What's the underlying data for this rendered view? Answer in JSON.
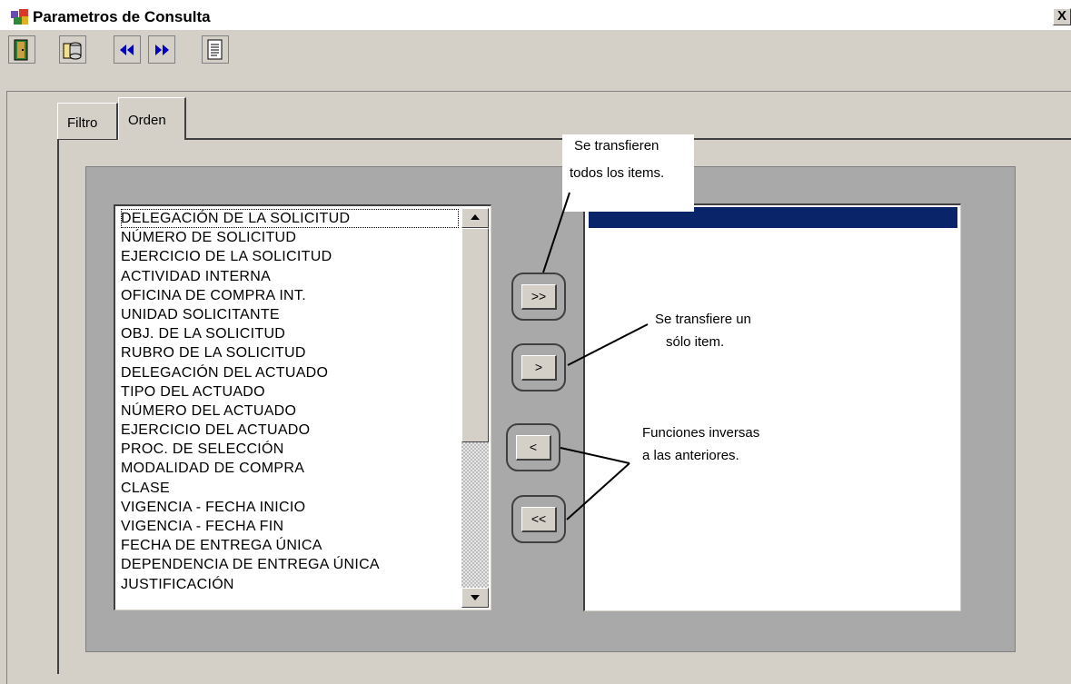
{
  "window": {
    "title": "Parametros de Consulta",
    "close_label": "X"
  },
  "toolbar": {
    "buttons": [
      {
        "icon": "exit-door-icon"
      },
      {
        "icon": "database-query-icon"
      },
      {
        "icon": "previous-icon"
      },
      {
        "icon": "next-icon"
      },
      {
        "icon": "report-document-icon"
      }
    ]
  },
  "tabs": [
    {
      "label": "Filtro"
    },
    {
      "label": "Orden",
      "active": true
    }
  ],
  "available_items": [
    "DELEGACIÓN DE LA SOLICITUD",
    "NÚMERO DE SOLICITUD",
    "EJERCICIO DE LA SOLICITUD",
    "ACTIVIDAD INTERNA",
    "OFICINA DE COMPRA  INT.",
    "UNIDAD SOLICITANTE",
    "OBJ. DE LA SOLICITUD",
    "RUBRO DE LA SOLICITUD",
    "DELEGACIÓN DEL ACTUADO",
    "TIPO DEL ACTUADO",
    "NÚMERO DEL ACTUADO",
    "EJERCICIO DEL ACTUADO",
    "PROC. DE SELECCIÓN",
    "MODALIDAD DE COMPRA",
    "CLASE",
    "VIGENCIA - FECHA INICIO",
    "VIGENCIA - FECHA FIN",
    "FECHA DE ENTREGA ÚNICA",
    "DEPENDENCIA DE ENTREGA ÚNICA",
    "JUSTIFICACIÓN"
  ],
  "transfer_buttons": {
    "all_right": ">>",
    "one_right": ">",
    "one_left": "<",
    "all_left": "<<"
  },
  "annotations": {
    "transfer_all_line1": "Se transfieren",
    "transfer_all_line2": "todos los items.",
    "transfer_one_line1": "Se transfiere un",
    "transfer_one_line2": "sólo item.",
    "inverse_line1": "Funciones inversas",
    "inverse_line2": "a las anteriores."
  },
  "colors": {
    "window_face": "#d4d0c8",
    "frame": "#a9a9a9",
    "selection": "#0a246a"
  }
}
